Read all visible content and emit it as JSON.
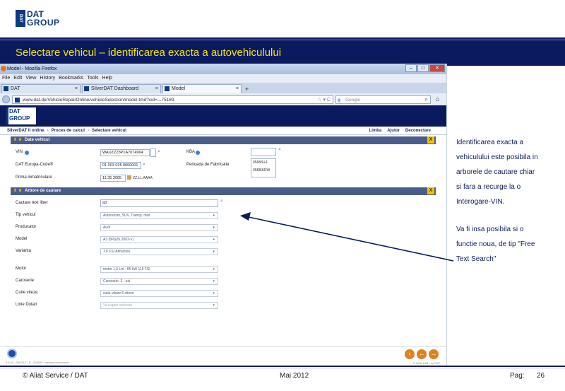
{
  "slide": {
    "logo_top": "DAT",
    "logo_bottom": "GROUP",
    "logo_box": "DAT",
    "title": "Selectare vehicul – identificarea exacta a autovehiculului"
  },
  "browser": {
    "window_title": "Model - Mozilla Firefox",
    "menu": [
      "File",
      "Edit",
      "View",
      "History",
      "Bookmarks",
      "Tools",
      "Help"
    ],
    "tabs": [
      {
        "label": "DAT"
      },
      {
        "label": "SilverDAT Dashboard"
      },
      {
        "label": "Model"
      }
    ],
    "url": "www.dat.de/VehicleRepairOnline/vehicleSelection/model.tmd?cid=...75189",
    "search_placeholder": "Google"
  },
  "app": {
    "logo_top": "DAT",
    "logo_bottom": "GROUP",
    "breadcrumb": [
      "SilverDAT II online",
      "Proces de calcul",
      "Selectare vehicul"
    ],
    "toplinks": [
      "Limba",
      "Ajutor",
      "Deconectare"
    ],
    "section_vehicle": "Date vehicul",
    "section_tree": "Arbore de cautare",
    "vehicle": {
      "vin_label": "VIN",
      "vin_value": "WAUZZZ8P1A7074964",
      "datcode_label": "DAT Europa-Code®",
      "datcode_value": "01 003 025 0000001",
      "reg_label": "Prima inmatriculare",
      "reg_value": "11.35 2005",
      "reg_hint": "ZZ.LL.AAAA",
      "kba_label": "KBA",
      "period_label": "Perioada de Fabricatie",
      "period_values": [
        "0588/6+1",
        "0588/ADW"
      ]
    },
    "tree": {
      "free_text_label": "Cautare text liber",
      "free_text_value": "a3",
      "rows": [
        {
          "label": "Tip vehicul",
          "value": "Autoturism, SUV, Transp. mixt"
        },
        {
          "label": "Producator",
          "value": "Audi"
        },
        {
          "label": "Model",
          "value": "A3 (8P)(05.2003->)"
        },
        {
          "label": "Varianta",
          "value": "1.6 FSI Attraction"
        },
        {
          "label": "Motor",
          "value": "motor 1,6 Ltrl - 85 kW 115 FSI"
        },
        {
          "label": "Caroserie",
          "value": "Caroserie: 2 - usi"
        },
        {
          "label": "Cutie viteze",
          "value": "cutie viteze 6 viteze"
        },
        {
          "label": "Linie Dotari",
          "value": "Va rugam selectati"
        }
      ]
    },
    "status_version": "3.4.42 - 06/2012 - D - 000000 / webservice/vehicle",
    "status_copy": "© 2006 DAT - by DAT"
  },
  "annotation": {
    "lines1": [
      "Identificarea exacta  a",
      "vehiculului este posibila in",
      "arborele de cautare chiar",
      "si fara  a recurge la o",
      "Interogare-VIN."
    ],
    "lines2": [
      "Va fi insa posibila si o",
      "functie noua, de tip \"Free",
      "Text Search\""
    ]
  },
  "footer": {
    "left": "© Aliat Service / DAT",
    "center": "Mai 2012",
    "page_label": "Pag:",
    "page_number": "26"
  },
  "colors": {
    "band": "#0b1a5e",
    "title": "#f5e600",
    "section": "#4a5c8a"
  }
}
